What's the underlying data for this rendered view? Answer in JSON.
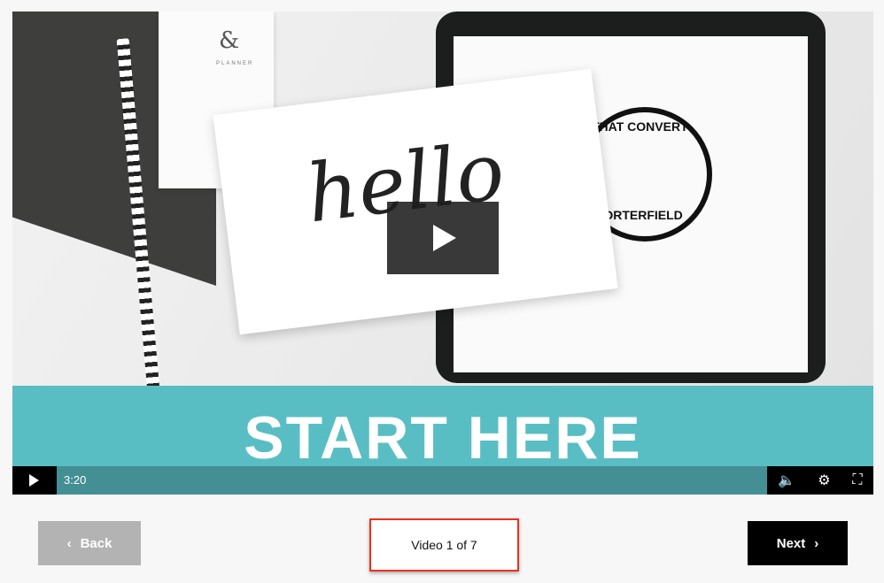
{
  "video": {
    "thumbnail": {
      "planner_text": "PLANNER",
      "card_text": "hello",
      "seal_top": "THAT CONVERT",
      "seal_bottom": "PORTERFIELD",
      "banner_text": "START HERE"
    },
    "duration": "3:20",
    "icons": {
      "play": "play-icon",
      "volume": "volume-icon",
      "settings": "gear-icon",
      "fullscreen": "fullscreen-icon"
    }
  },
  "nav": {
    "back_label": "Back",
    "next_label": "Next",
    "counter": "Video 1 of 7",
    "highlight_color": "#e8331c"
  }
}
